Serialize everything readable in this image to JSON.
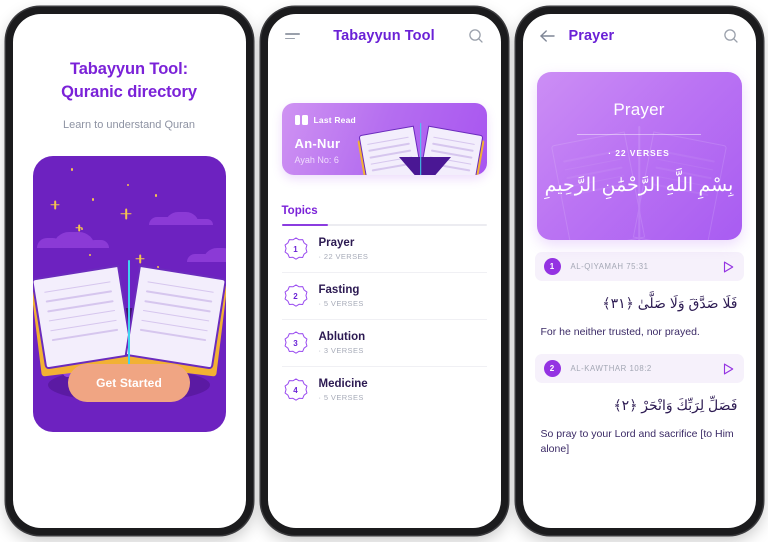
{
  "screen1": {
    "headline_line1": "Tabayyun Tool:",
    "headline_line2": "Quranic directory",
    "subtitle": "Learn to understand Quran",
    "cta_label": "Get Started"
  },
  "screen2": {
    "appbar": {
      "menu_icon": "hamburger-icon",
      "title": "Tabayyun Tool",
      "search_icon": "search-icon"
    },
    "last_read": {
      "label": "Last Read",
      "icon": "open-book-icon",
      "surah": "An-Nur",
      "ayah": "Ayah No: 6"
    },
    "tabs": [
      {
        "label": "Topics",
        "active": true
      }
    ],
    "topics": [
      {
        "num": "1",
        "name": "Prayer",
        "meta": "· 22 VERSES"
      },
      {
        "num": "2",
        "name": "Fasting",
        "meta": "· 5 VERSES"
      },
      {
        "num": "3",
        "name": "Ablution",
        "meta": "· 3 VERSES"
      },
      {
        "num": "4",
        "name": "Medicine",
        "meta": "· 5 VERSES"
      }
    ]
  },
  "screen3": {
    "appbar": {
      "back_icon": "arrow-left-icon",
      "title": "Prayer",
      "search_icon": "search-icon"
    },
    "hero": {
      "title": "Prayer",
      "meta": "· 22 VERSES",
      "basmala": "بِسْمِ اللَّهِ الرَّحْمَٰنِ الرَّحِيمِ"
    },
    "verses": [
      {
        "num": "1",
        "reference": "AL-QIYAMAH 75:31",
        "arabic": "فَلَا صَدَّقَ وَلَا صَلَّىٰ ﴿٣١﴾",
        "translation": "For he neither trusted, nor prayed.",
        "play_icon": "play-icon"
      },
      {
        "num": "2",
        "reference": "AL-KAWTHAR 108:2",
        "arabic": "فَصَلِّ لِرَبِّكَ وَانْحَرْ ﴿٢﴾",
        "translation": "So pray to your Lord and sacrifice [to Him alone]",
        "play_icon": "play-icon"
      }
    ]
  },
  "colors": {
    "brand_purple": "#7b22d8",
    "deep_purple": "#6d22c0",
    "accent_peach": "#f0a583",
    "card_gradient_from": "#cf93f2",
    "card_gradient_to": "#a855f0",
    "muted_text": "#a7abb8",
    "gold_edge": "#f2b134",
    "spine_cyan": "#3fd2ef"
  }
}
